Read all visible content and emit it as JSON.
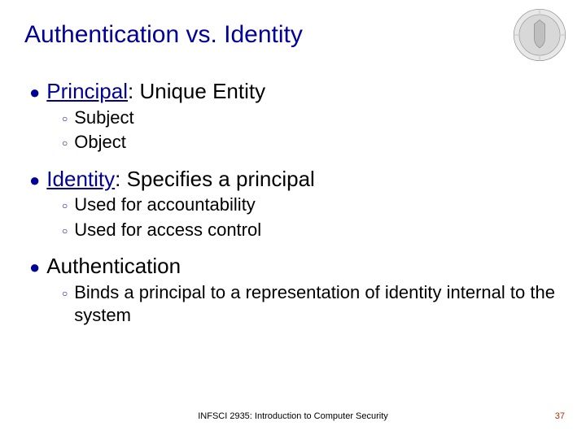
{
  "title": "Authentication vs. Identity",
  "items": [
    {
      "term": "Principal",
      "rest": ":  Unique Entity",
      "underline": true,
      "subs": [
        "Subject",
        "Object"
      ]
    },
    {
      "term": "Identity",
      "rest": ":  Specifies a principal",
      "underline": true,
      "subs": [
        "Used for accountability",
        "Used for access control"
      ]
    },
    {
      "term": "Authentication",
      "rest": "",
      "underline": false,
      "subs": [
        "Binds a principal to a representation of identity internal to the system"
      ]
    }
  ],
  "footer": {
    "center": "INFSCI 2935: Introduction to Computer Security",
    "page": "37"
  }
}
